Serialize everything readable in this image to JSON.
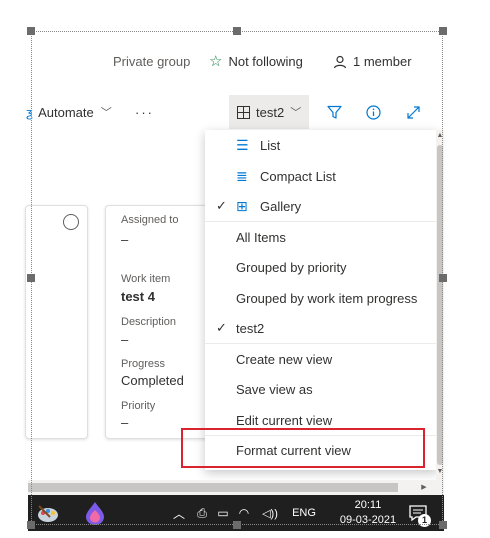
{
  "header": {
    "privacy": "Private group",
    "follow": "Not following",
    "members": "1 member"
  },
  "toolbar": {
    "automate": "Automate",
    "more": "···",
    "view_name": "test2"
  },
  "cards": [
    {
      "fields": [
        {
          "label": "Assigned to",
          "value": "–"
        },
        {
          "label": "Work item",
          "value": "test 4"
        },
        {
          "label": "Description",
          "value": "–"
        },
        {
          "label": "Progress",
          "value": "Completed"
        },
        {
          "label": "Priority",
          "value": "–"
        }
      ]
    }
  ],
  "menu": {
    "items": [
      {
        "label": "List",
        "icon": "list-icon",
        "checked": false
      },
      {
        "label": "Compact List",
        "icon": "compact-list-icon",
        "checked": false
      },
      {
        "label": "Gallery",
        "icon": "gallery-icon",
        "checked": true
      },
      {
        "label": "All Items",
        "checked": false
      },
      {
        "label": "Grouped by priority",
        "checked": false
      },
      {
        "label": "Grouped by work item progress",
        "checked": false
      },
      {
        "label": "test2",
        "checked": true
      },
      {
        "label": "Create new view",
        "checked": false
      },
      {
        "label": "Save view as",
        "checked": false
      },
      {
        "label": "Edit current view",
        "checked": false
      },
      {
        "label": "Format current view",
        "checked": false
      }
    ]
  },
  "taskbar": {
    "language": "ENG",
    "time": "20:11",
    "date": "09-03-2021",
    "notification_count": "1"
  },
  "colors": {
    "accent": "#0078d4",
    "highlight": "#d9232d",
    "star": "#107c41"
  }
}
